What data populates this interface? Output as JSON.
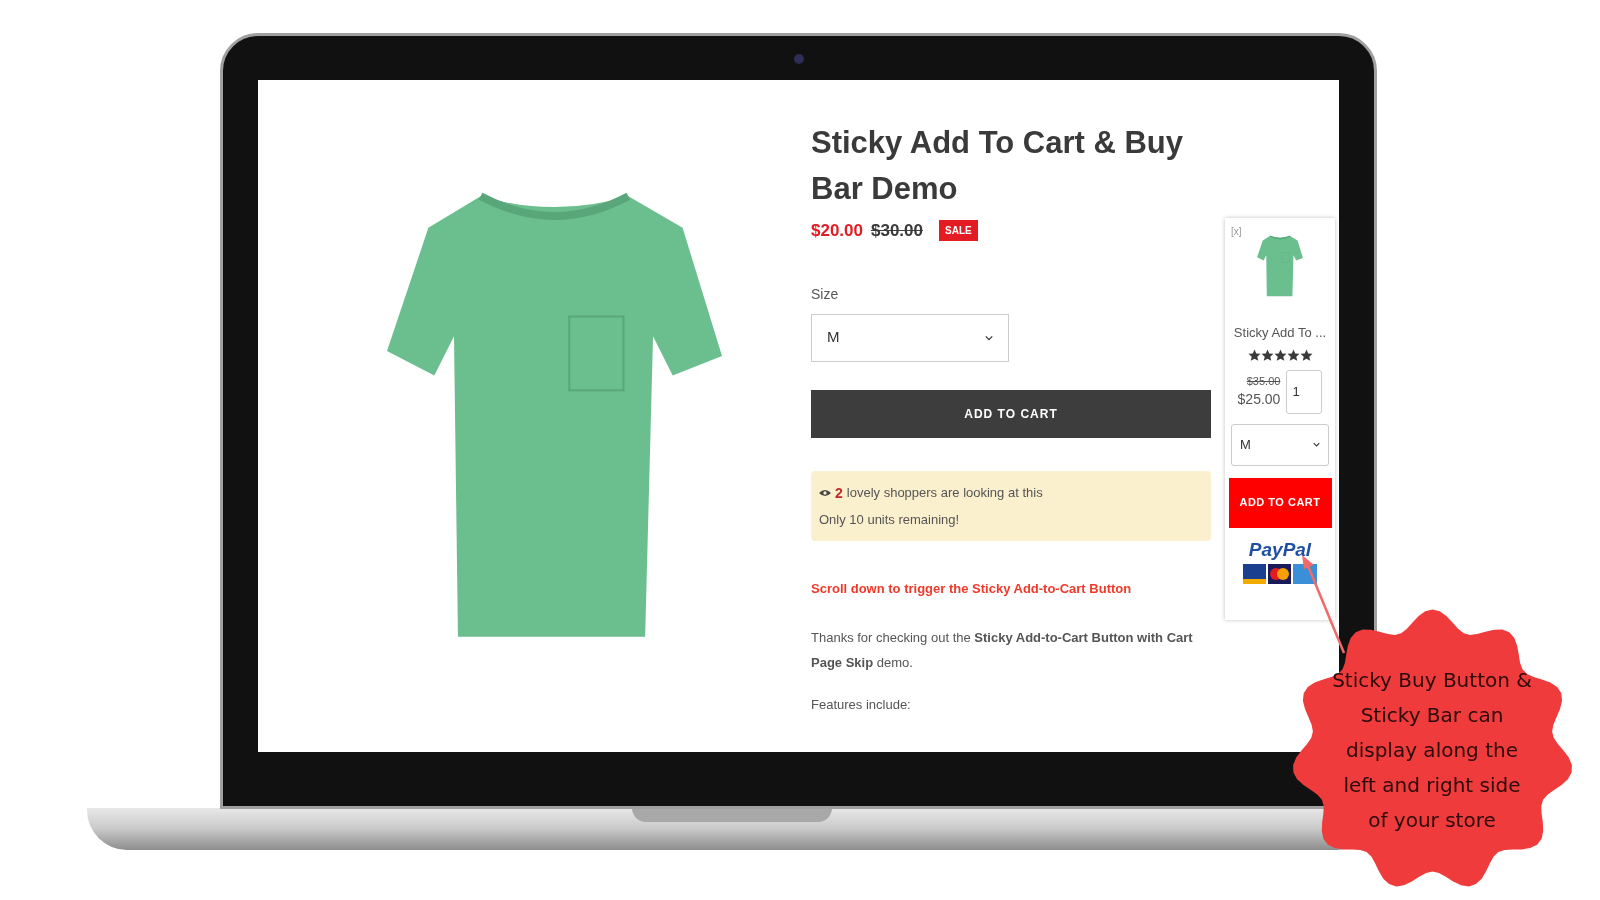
{
  "product": {
    "title": "Sticky Add To Cart & Buy Bar Demo",
    "price": "$20.00",
    "compare_price": "$30.00",
    "badge": "SALE",
    "size_label": "Size",
    "size_value": "M",
    "add_button": "ADD TO CART",
    "urgency": {
      "count": "2",
      "viewers_text": "lovely shoppers are looking at this",
      "stock_text": "Only 10 units remaining!"
    },
    "scroll_note": "Scroll down to trigger the Sticky Add-to-Cart Button",
    "description": "Thanks for checking out the **Sticky Add-to-Cart Button with Cart Page Skip** demo.",
    "features_heading": "Features include:"
  },
  "sticky_bar": {
    "close": "[x]",
    "title": "Sticky Add To ...",
    "stars": 5,
    "compare_price": "$35.00",
    "price": "$25.00",
    "quantity": "1",
    "size_value": "M",
    "add_button": "ADD TO CART",
    "paypal": "PayPal"
  },
  "callout": "Sticky Buy Button & Sticky Bar can display along the left and right side of your store"
}
